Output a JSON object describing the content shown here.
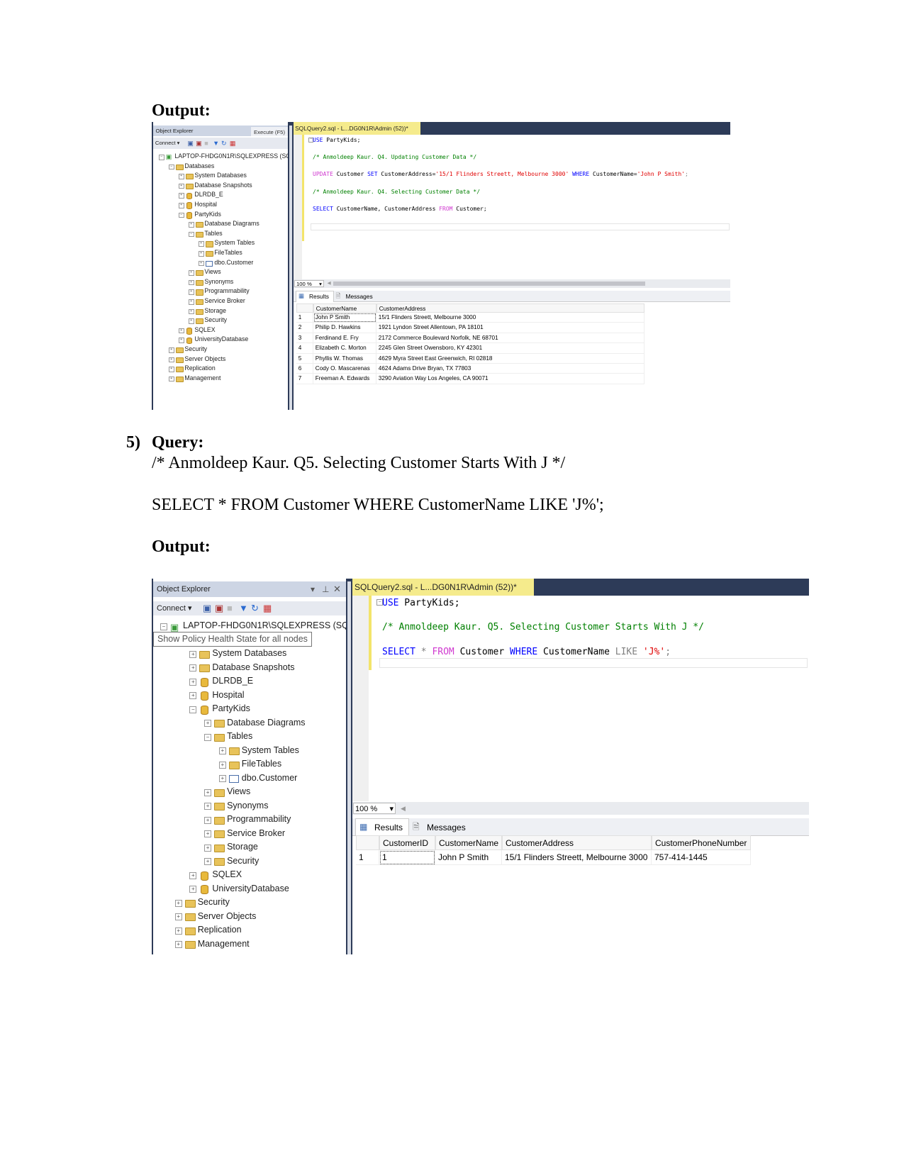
{
  "doc": {
    "output_label_1": "Output:",
    "q5_number": "5)",
    "q5_label": "Query:",
    "q5_comment": "/* Anmoldeep Kaur. Q5. Selecting Customer Starts With J */",
    "q5_sql": "SELECT * FROM Customer WHERE CustomerName LIKE 'J%';",
    "output_label_2": "Output:"
  },
  "shot1": {
    "oe_title": "Object Explorer",
    "execute_tab": "Execute (F5)",
    "connect": "Connect ▾",
    "query_tab": "SQLQuery2.sql - L...DG0N1R\\Admin (52))*",
    "tree": [
      {
        "label": "LAPTOP-FHDG0N1R\\SQLEXPRESS (SQL",
        "level": 0,
        "icon": "server",
        "state": "expanded"
      },
      {
        "label": "Databases",
        "level": 1,
        "icon": "folder",
        "state": "expanded"
      },
      {
        "label": "System Databases",
        "level": 2,
        "icon": "folder",
        "state": "collapsed"
      },
      {
        "label": "Database Snapshots",
        "level": 2,
        "icon": "folder",
        "state": "collapsed"
      },
      {
        "label": "DLRDB_E",
        "level": 2,
        "icon": "database",
        "state": "collapsed"
      },
      {
        "label": "Hospital",
        "level": 2,
        "icon": "database",
        "state": "collapsed"
      },
      {
        "label": "PartyKids",
        "level": 2,
        "icon": "database",
        "state": "expanded"
      },
      {
        "label": "Database Diagrams",
        "level": 3,
        "icon": "folder",
        "state": "collapsed"
      },
      {
        "label": "Tables",
        "level": 3,
        "icon": "folder",
        "state": "expanded"
      },
      {
        "label": "System Tables",
        "level": 4,
        "icon": "folder",
        "state": "collapsed"
      },
      {
        "label": "FileTables",
        "level": 4,
        "icon": "folder",
        "state": "collapsed"
      },
      {
        "label": "dbo.Customer",
        "level": 4,
        "icon": "table",
        "state": "collapsed"
      },
      {
        "label": "Views",
        "level": 3,
        "icon": "folder",
        "state": "collapsed"
      },
      {
        "label": "Synonyms",
        "level": 3,
        "icon": "folder",
        "state": "collapsed"
      },
      {
        "label": "Programmability",
        "level": 3,
        "icon": "folder",
        "state": "collapsed"
      },
      {
        "label": "Service Broker",
        "level": 3,
        "icon": "folder",
        "state": "collapsed"
      },
      {
        "label": "Storage",
        "level": 3,
        "icon": "folder",
        "state": "collapsed"
      },
      {
        "label": "Security",
        "level": 3,
        "icon": "folder",
        "state": "collapsed"
      },
      {
        "label": "SQLEX",
        "level": 2,
        "icon": "database",
        "state": "collapsed"
      },
      {
        "label": "UniversityDatabase",
        "level": 2,
        "icon": "database",
        "state": "collapsed"
      },
      {
        "label": "Security",
        "level": 1,
        "icon": "folder",
        "state": "collapsed"
      },
      {
        "label": "Server Objects",
        "level": 1,
        "icon": "folder",
        "state": "collapsed"
      },
      {
        "label": "Replication",
        "level": 1,
        "icon": "folder",
        "state": "collapsed"
      },
      {
        "label": "Management",
        "level": 1,
        "icon": "folder",
        "state": "collapsed"
      }
    ],
    "code": [
      [
        [
          "USE",
          "kw"
        ],
        [
          " PartyKids;",
          "tx"
        ]
      ],
      [
        [
          "/* Anmoldeep Kaur. Q4. Updating Customer  Data */",
          "cm"
        ]
      ],
      [
        [
          "UPDATE",
          "kw2"
        ],
        [
          " Customer ",
          "tx"
        ],
        [
          "SET",
          "kw"
        ],
        [
          " CustomerAddress=",
          "tx"
        ],
        [
          "'15/1 Flinders Streett, Melbourne 3000'",
          "st"
        ],
        [
          " WHERE",
          "kw"
        ],
        [
          " CustomerName=",
          "tx"
        ],
        [
          "'John P Smith'",
          "st"
        ],
        [
          ";",
          "gr"
        ]
      ],
      [
        [
          "/* Anmoldeep Kaur. Q4. Selecting Customer Data */",
          "cm"
        ]
      ],
      [
        [
          "SELECT",
          "kw"
        ],
        [
          " CustomerName, CustomerAddress ",
          "tx"
        ],
        [
          "FROM",
          "kw2"
        ],
        [
          " Customer;",
          "tx"
        ]
      ]
    ],
    "zoom": "100 %",
    "tab_results": "Results",
    "tab_messages": "Messages",
    "columns": [
      "CustomerName",
      "CustomerAddress"
    ],
    "rows": [
      [
        "1",
        "John P Smith",
        "15/1 Flinders Streett, Melbourne 3000"
      ],
      [
        "2",
        "Philip D. Hawkins",
        "1921 Lyndon Street Allentown, PA 18101"
      ],
      [
        "3",
        "Ferdinand E. Fry",
        "2172 Commerce Boulevard Norfolk, NE 68701"
      ],
      [
        "4",
        "Elizabeth C. Morton",
        "2245 Glen Street Owensboro, KY 42301"
      ],
      [
        "5",
        "Phyllis W. Thomas",
        "4629 Myra Street East Greenwich, RI 02818"
      ],
      [
        "6",
        "Cody O. Mascarenas",
        "4624 Adams Drive Bryan, TX 77803"
      ],
      [
        "7",
        "Freeman A. Edwards",
        "3290 Aviation Way Los Angeles, CA 90071"
      ]
    ]
  },
  "shot2": {
    "oe_title": "Object Explorer",
    "connect": "Connect ▾",
    "query_tab": "SQLQuery2.sql - L...DG0N1R\\Admin (52))*",
    "tooltip": "Show Policy Health State for all nodes",
    "code": [
      [
        [
          "USE",
          "kw"
        ],
        [
          " PartyKids;",
          "tx"
        ]
      ],
      [
        [
          "/* Anmoldeep Kaur. Q5. Selecting Customer Starts With J */",
          "cm"
        ]
      ],
      [
        [
          "SELECT",
          "kw"
        ],
        [
          " * ",
          "gr"
        ],
        [
          "FROM",
          "kw2"
        ],
        [
          " Customer ",
          "tx"
        ],
        [
          "WHERE",
          "kw"
        ],
        [
          " CustomerName ",
          "tx"
        ],
        [
          "LIKE",
          "gr"
        ],
        [
          " 'J%'",
          "st"
        ],
        [
          ";",
          "gr"
        ]
      ]
    ],
    "zoom": "100 %",
    "tab_results": "Results",
    "tab_messages": "Messages",
    "columns": [
      "CustomerID",
      "CustomerName",
      "CustomerAddress",
      "CustomerPhoneNumber"
    ],
    "rows": [
      [
        "1",
        "1",
        "John P Smith",
        "15/1 Flinders Streett, Melbourne 3000",
        "757-414-1445"
      ]
    ]
  },
  "colors": {
    "title_bar": "#2d3b58",
    "tab_active": "#f5eb8c",
    "keyword": "#0000ff",
    "comment": "#008000",
    "string": "#e00000"
  }
}
